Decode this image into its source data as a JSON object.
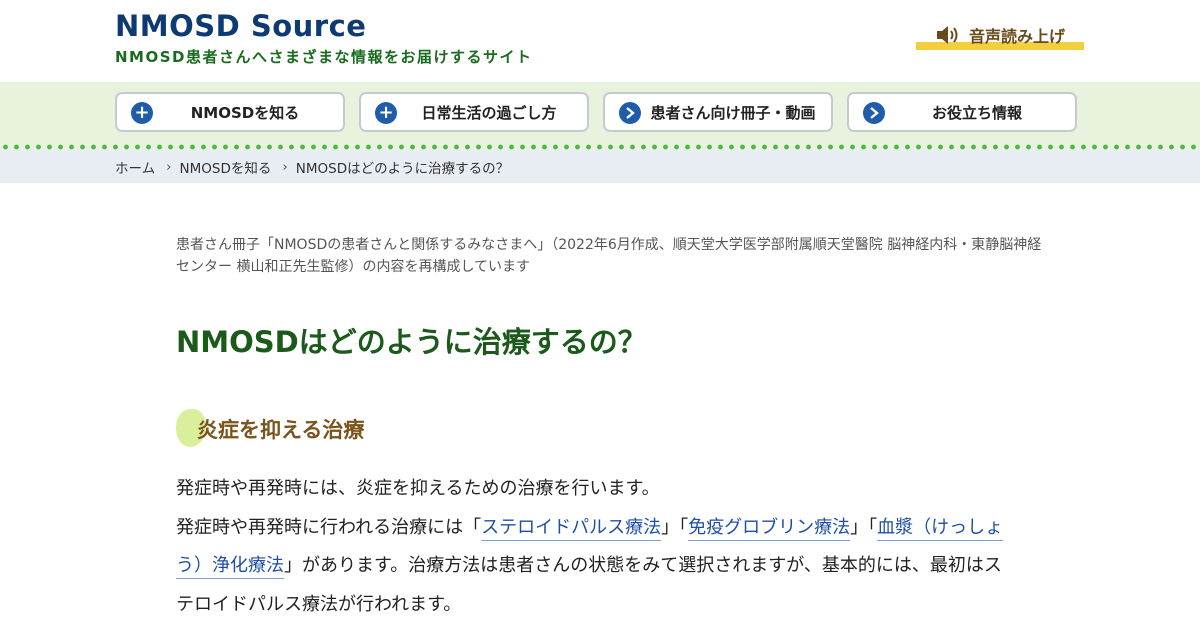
{
  "header": {
    "logo_title": "NMOSD Source",
    "logo_subtitle": "NMOSD患者さんへさまざまな情報をお届けするサイト",
    "voice_button": "音声読み上げ",
    "voice_icon": "speaker-icon"
  },
  "nav": {
    "items": [
      {
        "label": "NMOSDを知る",
        "icon": "plus-icon"
      },
      {
        "label": "日常生活の過ごし方",
        "icon": "plus-icon"
      },
      {
        "label": "患者さん向け冊子・動画",
        "icon": "chevron-right-icon"
      },
      {
        "label": "お役立ち情報",
        "icon": "chevron-right-icon"
      }
    ]
  },
  "breadcrumb": {
    "items": [
      "ホーム",
      "NMOSDを知る",
      "NMOSDはどのように治療するの？"
    ],
    "separator": "›"
  },
  "content": {
    "source_note": "患者さん冊子「NMOSDの患者さんと関係するみなさまへ」（2022年6月作成、順天堂大学医学部附属順天堂醫院 脳神経内科・東静脳神経センター 横山和正先生監修）の内容を再構成しています",
    "title": "NMOSDはどのように治療するの？",
    "section_heading": "炎症を抑える治療",
    "paragraph1": "発症時や再発時には、炎症を抑えるための治療を行います。",
    "p2_intro": "発症時や再発時に行われる治療には「",
    "link_steroid": "ステロイドパルス療法",
    "p2_sep1": "」「",
    "link_ivig": "免疫グロブリン療法",
    "p2_sep2": "」「",
    "link_plasma": "血漿（けっしょう）浄化療法",
    "p2_rest": "」があります。治療方法は患者さんの状態をみて選択されますが、基本的には、最初はステロイドパルス療法が行われます。"
  },
  "colors": {
    "logo": "#0d3a73",
    "tagline": "#1a6a1f",
    "nav_band": "#e9f2dd",
    "nav_icon": "#1f5caa",
    "dots": "#4cb848",
    "breadcrumb_bg": "#e8ecf3",
    "title": "#1c5a1c",
    "section_heading": "#7a531d",
    "section_blob": "#d9ef9a",
    "voice_underline": "#f4cf3c",
    "link": "#1f4fa5"
  }
}
